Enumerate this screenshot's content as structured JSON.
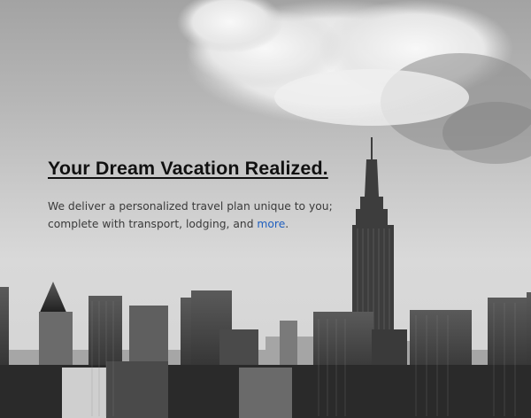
{
  "hero": {
    "title": "Your Dream Vacation Realized.",
    "tagline_line1": "We deliver a personalized travel plan unique to you;",
    "tagline_line2_prefix": "complete with transport, lodging, and ",
    "more_link": "more",
    "tagline_end": ".",
    "link_color": "#1f5fbf",
    "image": "black-and-white city skyline with clouds"
  }
}
